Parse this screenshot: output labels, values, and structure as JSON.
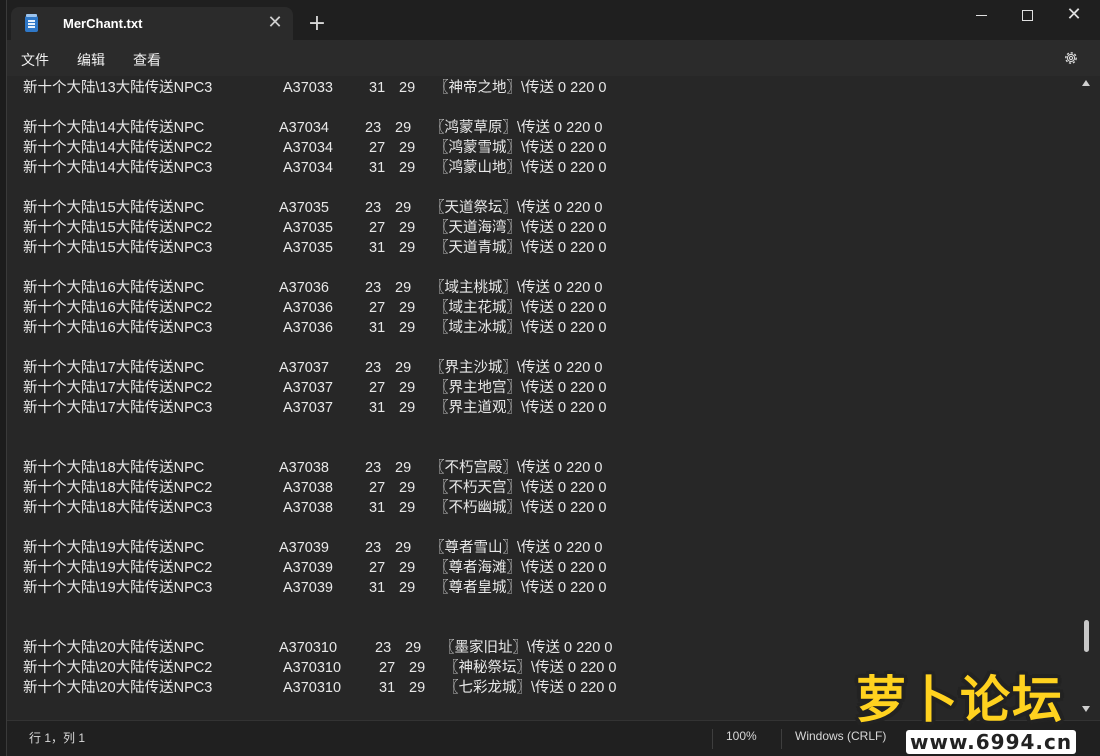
{
  "window": {
    "tab_title": "MerChant.txt",
    "tab_close_glyph": "✕",
    "new_tab_glyph": "+",
    "close_glyph": "✕"
  },
  "menu": {
    "file": "文件",
    "edit": "编辑",
    "view": "查看"
  },
  "lines": [
    {
      "name": "新十个大陆\\13大陆传送NPC3",
      "code": "A37033",
      "x": "31",
      "y": "29",
      "target": "〖神帝之地〗\\传送 0 220 0"
    },
    null,
    {
      "name": "新十个大陆\\14大陆传送NPC",
      "code": "A37034",
      "x": "23",
      "y": "29",
      "target": "〖鸿蒙草原〗\\传送 0 220 0"
    },
    {
      "name": "新十个大陆\\14大陆传送NPC2",
      "code": "A37034",
      "x": "27",
      "y": "29",
      "target": "〖鸿蒙雪城〗\\传送 0 220 0"
    },
    {
      "name": "新十个大陆\\14大陆传送NPC3",
      "code": "A37034",
      "x": "31",
      "y": "29",
      "target": "〖鸿蒙山地〗\\传送 0 220 0"
    },
    null,
    {
      "name": "新十个大陆\\15大陆传送NPC",
      "code": "A37035",
      "x": "23",
      "y": "29",
      "target": "〖天道祭坛〗\\传送 0 220 0"
    },
    {
      "name": "新十个大陆\\15大陆传送NPC2",
      "code": "A37035",
      "x": "27",
      "y": "29",
      "target": "〖天道海湾〗\\传送 0 220 0"
    },
    {
      "name": "新十个大陆\\15大陆传送NPC3",
      "code": "A37035",
      "x": "31",
      "y": "29",
      "target": "〖天道青城〗\\传送 0 220 0"
    },
    null,
    {
      "name": "新十个大陆\\16大陆传送NPC",
      "code": "A37036",
      "x": "23",
      "y": "29",
      "target": "〖域主桃城〗\\传送 0 220 0"
    },
    {
      "name": "新十个大陆\\16大陆传送NPC2",
      "code": "A37036",
      "x": "27",
      "y": "29",
      "target": "〖域主花城〗\\传送 0 220 0"
    },
    {
      "name": "新十个大陆\\16大陆传送NPC3",
      "code": "A37036",
      "x": "31",
      "y": "29",
      "target": "〖域主冰城〗\\传送 0 220 0"
    },
    null,
    {
      "name": "新十个大陆\\17大陆传送NPC",
      "code": "A37037",
      "x": "23",
      "y": "29",
      "target": "〖界主沙城〗\\传送 0 220 0"
    },
    {
      "name": "新十个大陆\\17大陆传送NPC2",
      "code": "A37037",
      "x": "27",
      "y": "29",
      "target": "〖界主地宫〗\\传送 0 220 0"
    },
    {
      "name": "新十个大陆\\17大陆传送NPC3",
      "code": "A37037",
      "x": "31",
      "y": "29",
      "target": "〖界主道观〗\\传送 0 220 0"
    },
    null,
    null,
    {
      "name": "新十个大陆\\18大陆传送NPC",
      "code": "A37038",
      "x": "23",
      "y": "29",
      "target": "〖不朽宫殿〗\\传送 0 220 0"
    },
    {
      "name": "新十个大陆\\18大陆传送NPC2",
      "code": "A37038",
      "x": "27",
      "y": "29",
      "target": "〖不朽天宫〗\\传送 0 220 0"
    },
    {
      "name": "新十个大陆\\18大陆传送NPC3",
      "code": "A37038",
      "x": "31",
      "y": "29",
      "target": "〖不朽幽城〗\\传送 0 220 0"
    },
    null,
    {
      "name": "新十个大陆\\19大陆传送NPC",
      "code": "A37039",
      "x": "23",
      "y": "29",
      "target": "〖尊者雪山〗\\传送 0 220 0"
    },
    {
      "name": "新十个大陆\\19大陆传送NPC2",
      "code": "A37039",
      "x": "27",
      "y": "29",
      "target": "〖尊者海滩〗\\传送 0 220 0"
    },
    {
      "name": "新十个大陆\\19大陆传送NPC3",
      "code": "A37039",
      "x": "31",
      "y": "29",
      "target": "〖尊者皇城〗\\传送 0 220 0"
    },
    null,
    null,
    {
      "name": "新十个大陆\\20大陆传送NPC",
      "code": "A370310",
      "x": "23",
      "y": "29",
      "target": "〖墨家旧址〗\\传送 0 220 0"
    },
    {
      "name": "新十个大陆\\20大陆传送NPC2",
      "code": "A370310",
      "x": "27",
      "y": "29",
      "target": "〖神秘祭坛〗\\传送 0 220 0"
    },
    {
      "name": "新十个大陆\\20大陆传送NPC3",
      "code": "A370310",
      "x": "31",
      "y": "29",
      "target": "〖七彩龙城〗\\传送 0 220 0"
    }
  ],
  "status": {
    "position": "行 1，列 1",
    "zoom": "100%",
    "line_ending": "Windows (CRLF)"
  },
  "watermark": {
    "title": "萝卜论坛",
    "url": "www.6994.cn"
  },
  "icons": {
    "app": "notepad-icon",
    "settings": "gear-icon"
  }
}
